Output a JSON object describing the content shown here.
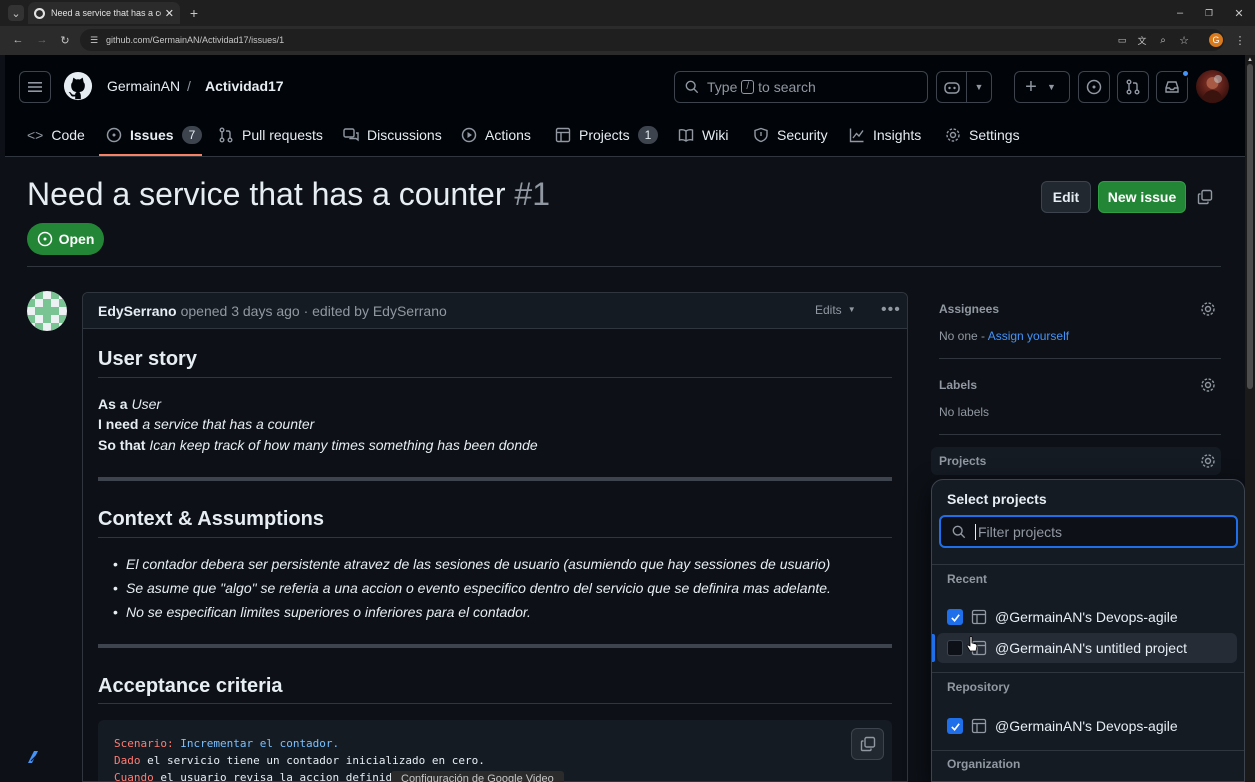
{
  "browser": {
    "tab_title": "Need a service that has a counter",
    "url": "github.com/GermainAN/Actividad17/issues/1",
    "profile_initial": "G"
  },
  "repo": {
    "owner": "GermainAN",
    "separator": "/",
    "name": "Actividad17"
  },
  "search": {
    "prefix": "Type",
    "key": "/",
    "suffix": "to search"
  },
  "nav_tabs": [
    {
      "label": "Code",
      "icon": "code-icon"
    },
    {
      "label": "Issues",
      "icon": "issue-opened-icon",
      "count": "7"
    },
    {
      "label": "Pull requests",
      "icon": "git-pull-request-icon"
    },
    {
      "label": "Discussions",
      "icon": "comment-discussion-icon"
    },
    {
      "label": "Actions",
      "icon": "play-icon"
    },
    {
      "label": "Projects",
      "icon": "table-icon",
      "count": "1"
    },
    {
      "label": "Wiki",
      "icon": "book-icon"
    },
    {
      "label": "Security",
      "icon": "shield-icon"
    },
    {
      "label": "Insights",
      "icon": "graph-icon"
    },
    {
      "label": "Settings",
      "icon": "gear-icon"
    }
  ],
  "issue": {
    "title": "Need a service that has a counter",
    "number": "#1",
    "state": "Open",
    "edit_label": "Edit",
    "new_issue_label": "New issue"
  },
  "comment": {
    "author": "EdySerrano",
    "meta": "opened 3 days ago · edited by EdySerrano",
    "edits_label": "Edits",
    "h_user_story": "User story",
    "as_label": "As a",
    "as_value": "User",
    "need_label": "I need",
    "need_value": "a service that has a counter",
    "so_label": "So that",
    "so_value": "Ican keep track of how many times something has been donde",
    "h_context": "Context & Assumptions",
    "bullets": [
      "El contador debera ser persistente atravez de las sesiones de usuario (asumiendo que hay sessiones de usuario)",
      "Se asume que \"algo\" se referia a una accion o evento especifico dentro del servicio que se definira mas adelante.",
      "No se especifican limites superiores o inferiores para el contador."
    ],
    "h_acceptance": "Acceptance criteria",
    "code": {
      "l1_kw": "Scenario:",
      "l1_rest": " Incrementar el contador.",
      "l2_kw": "Dado",
      "l2_rest": " el servicio tiene un contador inicializado en cero.",
      "l3_kw": "Cuando",
      "l3_rest": " el usuario revisa la accion definida."
    }
  },
  "sidebar": {
    "assignees_label": "Assignees",
    "assignees_value": "No one -",
    "assign_yourself": "Assign yourself",
    "labels_label": "Labels",
    "labels_value": "No labels",
    "projects_label": "Projects"
  },
  "project_picker": {
    "title": "Select projects",
    "filter_placeholder": "Filter projects",
    "sections": {
      "recent": "Recent",
      "repository": "Repository",
      "organization": "Organization"
    },
    "recent_items": [
      {
        "label": "@GermainAN's Devops-agile",
        "checked": true
      },
      {
        "label": "@GermainAN's untitled project",
        "checked": false
      }
    ],
    "repository_items": [
      {
        "label": "@GermainAN's Devops-agile",
        "checked": true
      }
    ]
  },
  "overlay": {
    "tooltip": "Configuración de Google Video"
  },
  "colors": {
    "accent": "#1f6feb",
    "open_green": "#238636",
    "link": "#4493f8",
    "underline_orange": "#f78166"
  }
}
